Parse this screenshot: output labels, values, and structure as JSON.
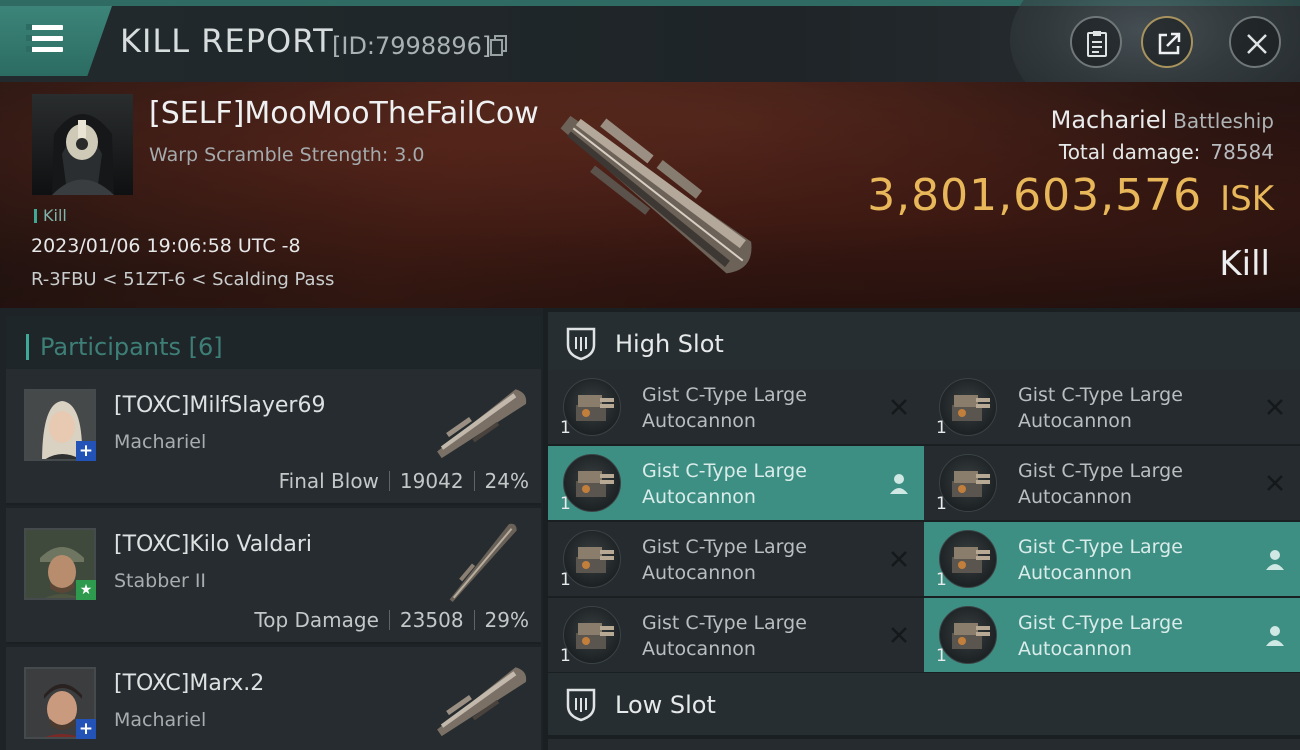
{
  "titlebar": {
    "title": "KILL REPORT",
    "report_id": "[ID:7998896]",
    "icons": [
      "menu-icon",
      "copy-icon",
      "clipboard-icon",
      "export-icon",
      "close-icon"
    ]
  },
  "victim": {
    "name": "[SELF]MooMooTheFailCow",
    "warp_scramble": "Warp Scramble Strength: 3.0",
    "tag": "Kill",
    "datetime": "2023/01/06 19:06:58 UTC -8",
    "location": "R-3FBU < 51ZT-6 < Scalding Pass",
    "ship_name": "Machariel",
    "ship_class": "Battleship",
    "total_damage_label": "Total damage:",
    "total_damage": "78584",
    "isk_value": "3,801,603,576",
    "isk_unit": "ISK",
    "result": "Kill"
  },
  "participants": {
    "header": "Participants [6]",
    "rows": [
      {
        "name": "[TOXC]MilfSlayer69",
        "ship": "Machariel",
        "role": "Final Blow",
        "damage": "19042",
        "percent": "24%",
        "badge": "+"
      },
      {
        "name": "[TOXC]Kilo Valdari",
        "ship": "Stabber II",
        "role": "Top Damage",
        "damage": "23508",
        "percent": "29%",
        "badge": "★"
      },
      {
        "name": "[TOXC]Marx.2",
        "ship": "Machariel",
        "role": "",
        "damage": "",
        "percent": "",
        "badge": "+"
      }
    ]
  },
  "slots": {
    "high_slot_label": "High Slot",
    "low_slot_label": "Low Slot",
    "modules": [
      {
        "name": "Gist C-Type Large Autocannon",
        "qty": "1",
        "state": "destroyed"
      },
      {
        "name": "Gist C-Type Large Autocannon",
        "qty": "1",
        "state": "destroyed"
      },
      {
        "name": "Gist C-Type Large Autocannon",
        "qty": "1",
        "state": "dropped"
      },
      {
        "name": "Gist C-Type Large Autocannon",
        "qty": "1",
        "state": "destroyed"
      },
      {
        "name": "Gist C-Type Large Autocannon",
        "qty": "1",
        "state": "destroyed"
      },
      {
        "name": "Gist C-Type Large Autocannon",
        "qty": "1",
        "state": "dropped"
      },
      {
        "name": "Gist C-Type Large Autocannon",
        "qty": "1",
        "state": "destroyed"
      },
      {
        "name": "Gist C-Type Large Autocannon",
        "qty": "1",
        "state": "dropped"
      }
    ]
  },
  "colors": {
    "accent": "#3e8f83",
    "isk": "#e8b75a",
    "badge_plus": "#2453b8",
    "badge_star": "#2d9a4d"
  }
}
